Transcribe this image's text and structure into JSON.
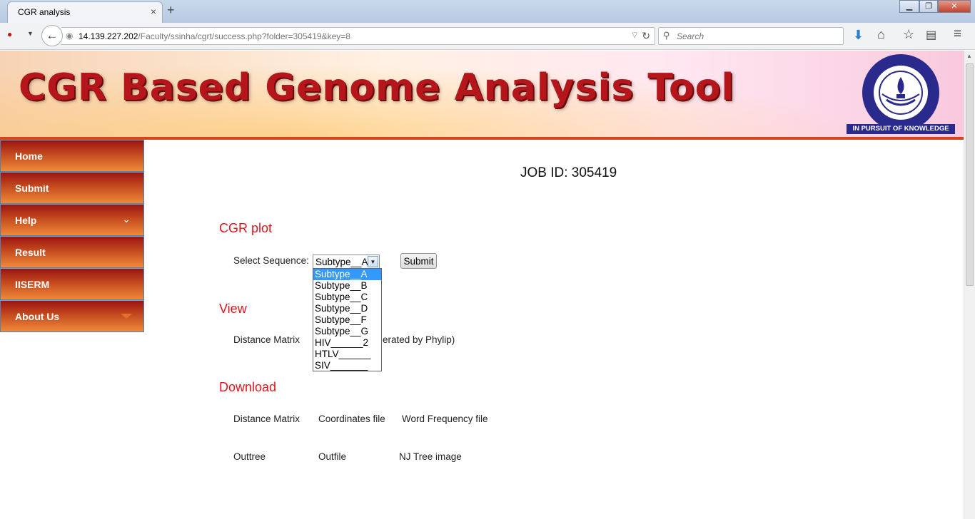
{
  "browser": {
    "tab_title": "CGR analysis",
    "tab_close": "×",
    "new_tab": "+",
    "url_host": "14.139.227.202",
    "url_path": "/Faculty/ssinha/cgrt/success.php?folder=305419&key=8",
    "search_placeholder": "Search",
    "window_buttons": [
      "minimize",
      "maximize",
      "close"
    ]
  },
  "banner": {
    "title": "CGR Based Genome Analysis Tool",
    "logo_caption": "IN PURSUIT OF KNOWLEDGE",
    "logo_ring_text": "INDIAN INSTITUTE OF SCIENCE EDUCATION AND RESEARCH MOHALI"
  },
  "sidebar": {
    "items": [
      {
        "label": "Home"
      },
      {
        "label": "Submit"
      },
      {
        "label": "Help"
      },
      {
        "label": "Result"
      },
      {
        "label": "IISERM"
      },
      {
        "label": "About Us"
      }
    ]
  },
  "main": {
    "job_id": "JOB ID: 305419",
    "cgr_plot": {
      "heading": "CGR plot",
      "select_label": "Select Sequence:",
      "selected": "Subtype__A",
      "submit": "Submit",
      "options": [
        "Subtype__A",
        "Subtype__B",
        "Subtype__C",
        "Subtype__D",
        "Subtype__F",
        "Subtype__G",
        "HIV______2",
        "HTLV______",
        "SIV_______"
      ]
    },
    "view": {
      "heading": "View",
      "distance_matrix": "Distance Matrix",
      "phylip_note": "erated by Phylip)"
    },
    "download": {
      "heading": "Download",
      "row1": [
        "Distance Matrix",
        "Coordinates file",
        "Word Frequency file"
      ],
      "row2": [
        "Outtree",
        "Outfile",
        "NJ Tree image"
      ]
    }
  },
  "colors": {
    "heading_red": "#e0141c",
    "banner_red": "#b5161b",
    "menu_dark": "#9b1512",
    "menu_light": "#f08a3a",
    "dropdown_highlight": "#3399ff"
  }
}
